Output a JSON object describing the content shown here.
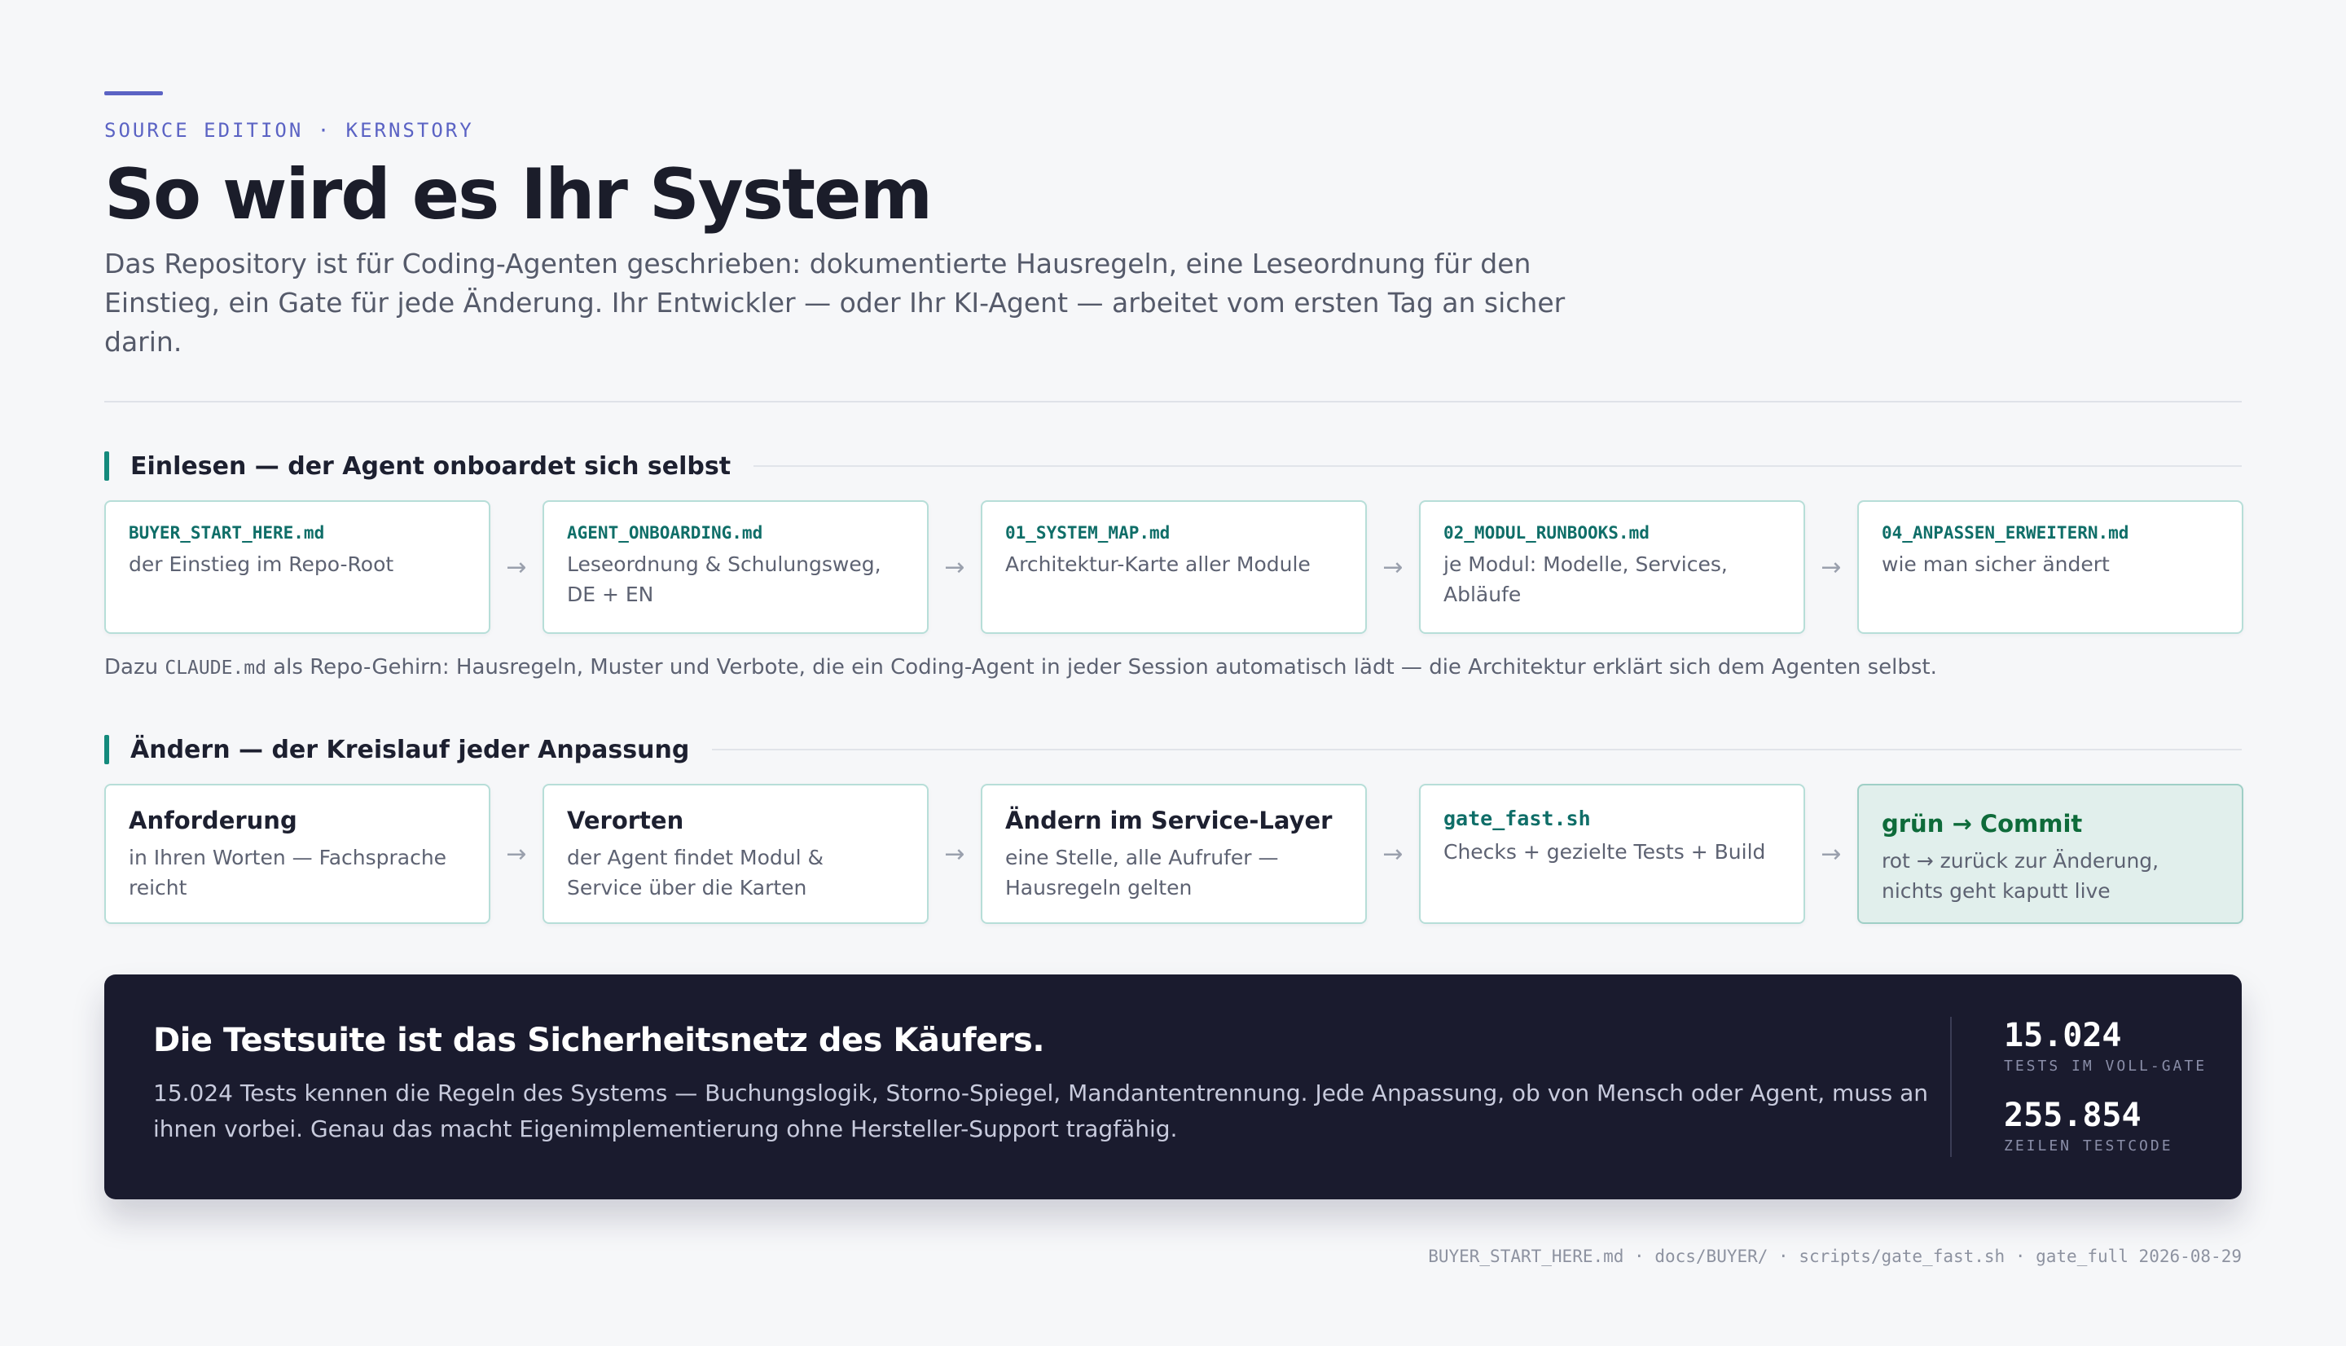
{
  "eyebrow": "SOURCE EDITION · KERNSTORY",
  "title": "So wird es Ihr System",
  "lede": "Das Repository ist für Coding-Agenten geschrieben: dokumentierte Hausregeln, eine Leseordnung für den Einstieg, ein Gate für jede Änderung. Ihr Entwickler — oder Ihr KI-Agent — arbeitet vom ersten Tag an sicher darin.",
  "section1": {
    "label": "Einlesen — der Agent onboardet sich selbst",
    "cards": [
      {
        "file": "BUYER_START_HERE.md",
        "desc": "der Einstieg im Repo-Root"
      },
      {
        "file": "AGENT_ONBOARDING.md",
        "desc": "Leseordnung & Schulungsweg, DE + EN"
      },
      {
        "file": "01_SYSTEM_MAP.md",
        "desc": "Architektur-Karte aller Module"
      },
      {
        "file": "02_MODUL_RUNBOOKS.md",
        "desc": "je Modul: Modelle, Services, Abläufe"
      },
      {
        "file": "04_ANPASSEN_ERWEITERN.md",
        "desc": "wie man sicher ändert"
      }
    ],
    "note_prefix": "Dazu ",
    "note_mono": "CLAUDE.md",
    "note_suffix": " als Repo-Gehirn: Hausregeln, Muster und Verbote, die ein Coding-Agent in jeder Session automatisch lädt — die Architektur erklärt sich dem Agenten selbst."
  },
  "section2": {
    "label": "Ändern — der Kreislauf jeder Anpassung",
    "cards": [
      {
        "step": "Anforderung",
        "desc": "in Ihren Worten — Fachsprache reicht"
      },
      {
        "step": "Verorten",
        "desc": "der Agent findet Modul & Service über die Karten"
      },
      {
        "step": "Ändern im Service-Layer",
        "desc": "eine Stelle, alle Aufrufer — Hausregeln gelten"
      },
      {
        "cmd": "gate_fast.sh",
        "desc": "Checks + gezielte Tests + Build"
      },
      {
        "step": "grün → Commit",
        "desc": "rot → zurück zur Änderung, nichts geht kaputt live"
      }
    ]
  },
  "arrow_glyph": "→",
  "banner": {
    "title": "Die Testsuite ist das Sicherheitsnetz des Käufers.",
    "text": "15.024 Tests kennen die Regeln des Systems — Buchungslogik, Storno-Spiegel, Mandantentrennung. Jede Anpassung, ob von Mensch oder Agent, muss an ihnen vorbei. Genau das macht Eigenimplementierung ohne Hersteller-Support tragfähig.",
    "stats": [
      {
        "value": "15.024",
        "label": "TESTS IM VOLL-GATE"
      },
      {
        "value": "255.854",
        "label": "ZEILEN TESTCODE"
      }
    ]
  },
  "footer": "BUYER_START_HERE.md · docs/BUYER/ · scripts/gate_fast.sh · gate_full 2026-08-29",
  "colors": {
    "accent": "#5b63c4",
    "teal": "#148a7c",
    "banner_bg": "#1a1b2e",
    "success": "#0e6b3a"
  }
}
